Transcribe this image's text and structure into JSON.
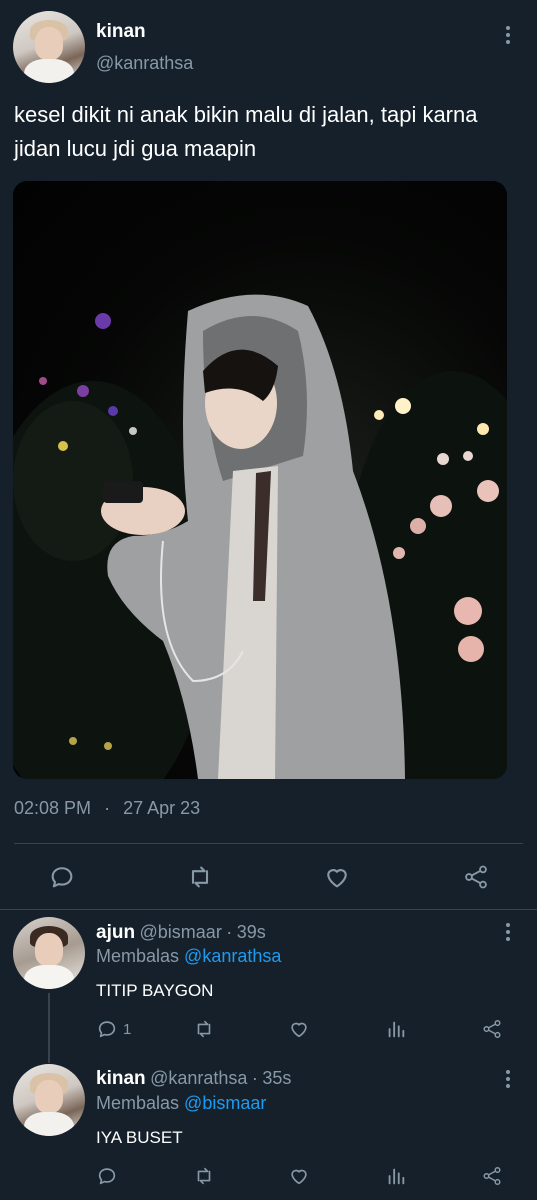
{
  "tweet": {
    "author_name": "kinan",
    "author_handle": "@kanrathsa",
    "text": "kesel dikit ni anak bikin malu di jalan, tapi karna jidan lucu jdi gua maapin",
    "time": "02:08 PM",
    "separator": "·",
    "date": "27 Apr 23",
    "actions": [
      "reply-icon",
      "retweet-icon",
      "like-icon",
      "share-icon"
    ]
  },
  "replies": [
    {
      "author_name": "ajun",
      "author_handle": "@bismaar",
      "time_sep": "·",
      "time": "39s",
      "replying_label": "Membalas",
      "replying_to": "@kanrathsa",
      "text": "TITIP BAYGON",
      "reply_count": "1"
    },
    {
      "author_name": "kinan",
      "author_handle": "@kanrathsa",
      "time_sep": "·",
      "time": "35s",
      "replying_label": "Membalas",
      "replying_to": "@bismaar",
      "text": "IYA BUSET",
      "reply_count": ""
    }
  ],
  "colors": {
    "background": "#15202b",
    "secondary_text": "#8899a6",
    "link": "#1d9bf0",
    "divider": "#38444d"
  }
}
